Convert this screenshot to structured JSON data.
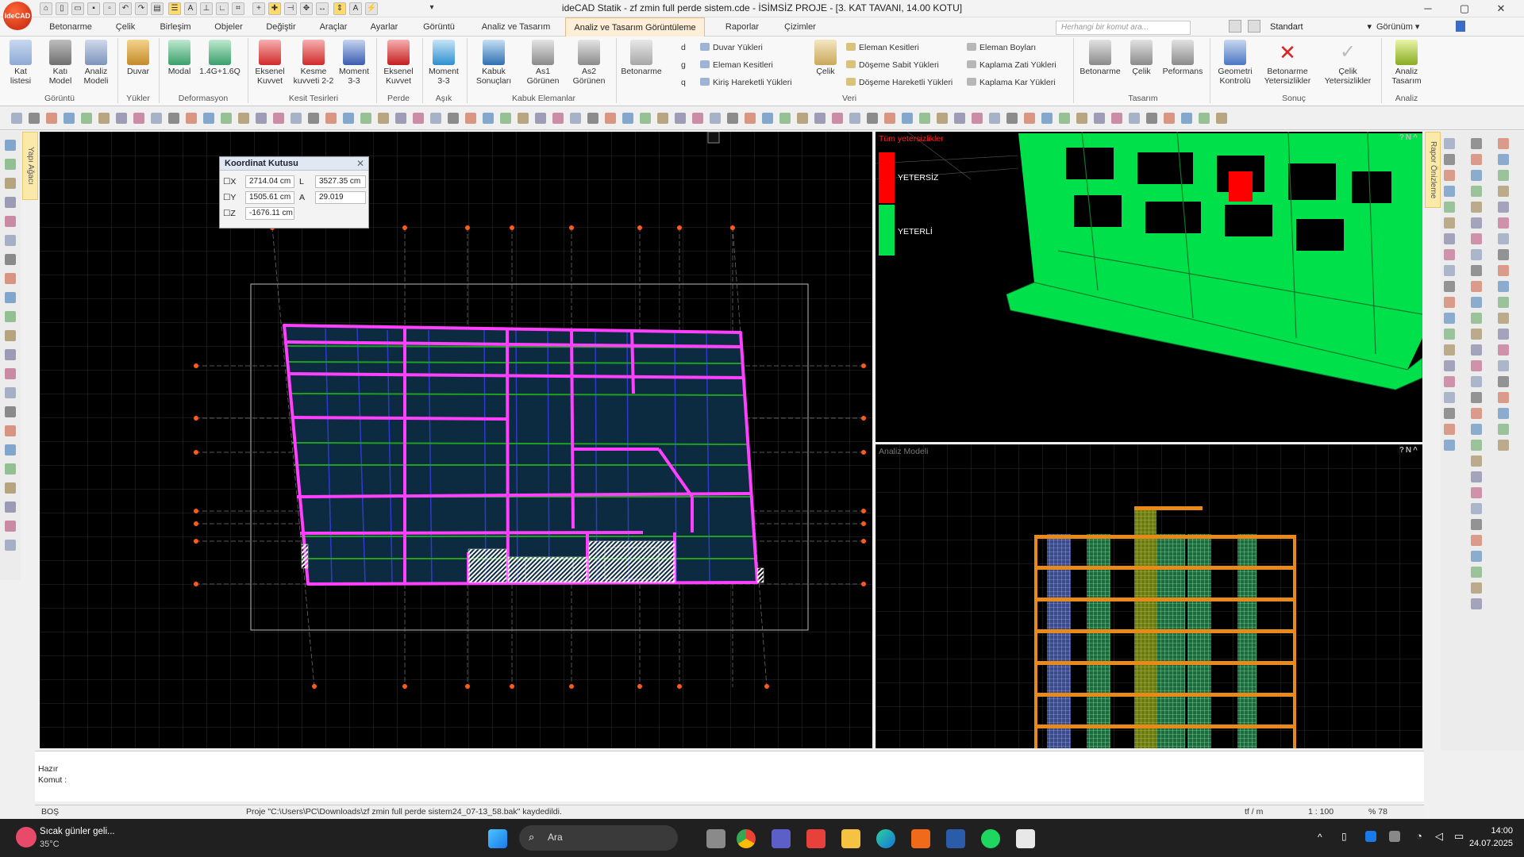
{
  "window": {
    "title": "ideCAD Statik - zf zmin full perde sistem.cde - İSİMSİZ PROJE - [3. KAT TAVANI, 14.00 KOTU]",
    "logo": "ideCAD"
  },
  "menus": [
    "Betonarme",
    "Çelik",
    "Birleşim",
    "Objeler",
    "Değiştir",
    "Araçlar",
    "Ayarlar",
    "Görüntü",
    "Analiz ve Tasarım",
    "Analiz ve Tasarım Görüntüleme",
    "Raporlar",
    "Çizimler"
  ],
  "command_search": {
    "placeholder": "Herhangi bir komut ara..."
  },
  "style_select": "Standart",
  "view_menu": "Görünüm",
  "ribbon": {
    "groups": [
      {
        "label": "Görüntü",
        "buttons": [
          "Kat listesi",
          "Katı Model",
          "Analiz Modeli"
        ]
      },
      {
        "label": "Yükler",
        "buttons": [
          "Duvar"
        ]
      },
      {
        "label": "Deformasyon",
        "buttons": [
          "Modal",
          "1.4G+1.6Q"
        ]
      },
      {
        "label": "Kesit Tesirleri",
        "buttons": [
          "Eksenel Kuvvet",
          "Kesme kuvveti 2-2",
          "Moment 3-3"
        ]
      },
      {
        "label": "Perde",
        "buttons": [
          "Eksenel Kuvvet"
        ]
      },
      {
        "label": "Aşık",
        "buttons": [
          "Moment 3-3"
        ]
      },
      {
        "label": "Kabuk Elemanlar",
        "buttons": [
          "Kabuk Sonuçları",
          "As1 Görünen",
          "As2 Görünen"
        ]
      },
      {
        "label": "Veri",
        "buttons": [
          "Betonarme",
          "Çelik"
        ]
      },
      {
        "label": "Tasarım",
        "buttons": [
          "Betonarme",
          "Çelik",
          "Peformans"
        ]
      },
      {
        "label": "Sonuç",
        "buttons": [
          "Geometri Kontrolü",
          "Betonarme Yetersizlikler",
          "Çelik Yetersizlikler"
        ]
      },
      {
        "label": "Analiz",
        "buttons": [
          "Analiz Tasarım"
        ]
      }
    ],
    "veri_small": [
      "Duvar Yükleri",
      "Eleman Kesitleri",
      "Kiriş Hareketli Yükleri",
      "Eleman Kesitleri",
      "Döşeme Sabit Yükleri",
      "Döşeme Hareketli Yükleri",
      "Eleman Boyları",
      "Kaplama Zati  Yükleri",
      "Kaplama Kar Yükleri"
    ],
    "veri_letters": [
      "d",
      "g",
      "q"
    ]
  },
  "left_panel_tab": "Yapı Ağacı",
  "right_panel_tab": "Rapor Önizleme",
  "coord_box": {
    "title": "Koordinat Kutusu",
    "x_label": "X",
    "x": "2714.04 cm",
    "y_label": "Y",
    "y": "1505.61 cm",
    "z_label": "Z",
    "z": "-1676.11 cm",
    "l_label": "L",
    "l": "3527.35 cm",
    "a_label": "A",
    "a": "29.019"
  },
  "viewport_3d": {
    "title": "Tüm yetersizlikler",
    "legend": [
      {
        "label": "YETERSİZ",
        "color": "#ff0000"
      },
      {
        "label": "YETERLİ",
        "color": "#00e04a"
      }
    ]
  },
  "viewport_analysis": {
    "title": "Analiz Modeli"
  },
  "view_controls": "?N^",
  "command": {
    "status": "Hazır",
    "prompt": "Komut :"
  },
  "statusbar": {
    "mode": "BOŞ",
    "message": "Proje \"C:\\Users\\PC\\Downloads\\zf zmin full perde sistem24_07-13_58.bak\" kaydedildi.",
    "unit": "tf / m",
    "scale": "1 : 100",
    "zoom": "% 78"
  },
  "taskbar": {
    "weather_title": "Sıcak günler geli...",
    "weather_temp": "35°C",
    "search": "Ara",
    "time": "14:00",
    "date": "24.07.2025"
  },
  "colors": {
    "accent": "#e8a040",
    "beam": "#ff40ff",
    "slab": "#0c2a40",
    "green_ok": "#00e04a",
    "red_fail": "#ff0000"
  }
}
